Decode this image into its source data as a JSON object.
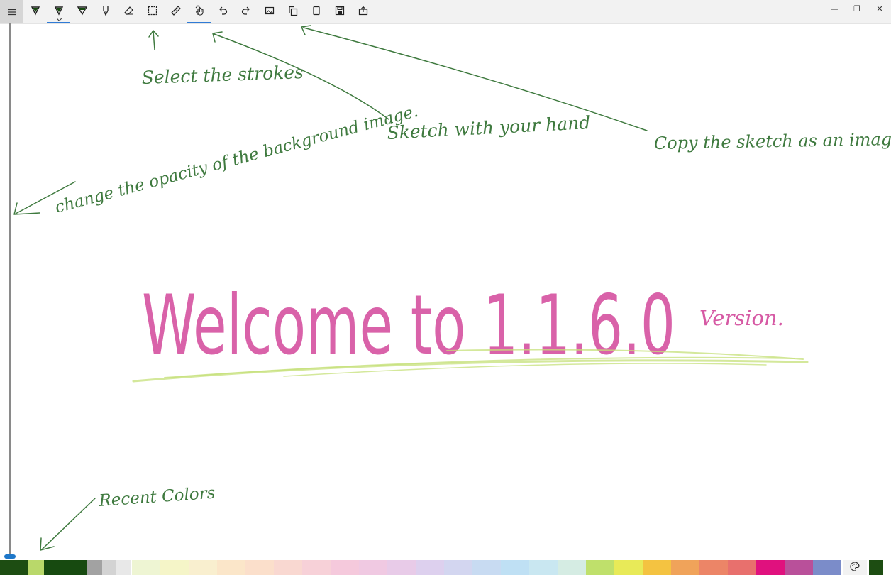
{
  "window": {
    "minimize_glyph": "—",
    "restore_glyph": "❐",
    "close_glyph": "✕"
  },
  "toolbar": {
    "tools": [
      {
        "name": "menu-icon"
      },
      {
        "name": "pen-icon"
      },
      {
        "name": "pencil-icon",
        "selected": true,
        "has_dropdown": true
      },
      {
        "name": "highlighter-icon"
      },
      {
        "name": "calligraphy-pen-icon"
      },
      {
        "name": "eraser-icon"
      },
      {
        "name": "selection-icon"
      },
      {
        "name": "ruler-icon"
      },
      {
        "name": "touch-writing-icon",
        "selected": true
      },
      {
        "name": "undo-icon"
      },
      {
        "name": "redo-icon"
      },
      {
        "name": "background-image-icon"
      },
      {
        "name": "copy-icon"
      },
      {
        "name": "page-icon"
      },
      {
        "name": "save-icon"
      },
      {
        "name": "share-icon"
      }
    ]
  },
  "annotations": {
    "select_strokes": "Select the strokes",
    "sketch_with_hand": "Sketch with your hand",
    "copy_sketch": "Copy the sketch as an image.",
    "opacity": "change the opacity of the background image.",
    "recent_colors": "Recent Colors"
  },
  "welcome": {
    "title": "Welcome to 1.1.6.0",
    "suffix": "Version."
  },
  "colors": {
    "ink_annotation": "#3f7a3f",
    "ink_welcome": "#d2479a",
    "ink_underline": "#c6e07a",
    "accent": "#2f7bd6",
    "recent": [
      "#1d4d12",
      "#b9d86a",
      "#174a10",
      "#174a10",
      "#a2a2a2",
      "#d3d3d3",
      "#e8e8e8"
    ],
    "palette": [
      "#eef5d3",
      "#f5f5c8",
      "#f9efcf",
      "#fbe6c9",
      "#fbdfcb",
      "#f9d8d1",
      "#f7d1d8",
      "#f5c9dc",
      "#f0c9e2",
      "#e8cbe8",
      "#ddd0ee",
      "#d3d6f0",
      "#c8dbf2",
      "#bfe0f4",
      "#c9e7f1",
      "#d5ece3",
      "#bfe06b",
      "#e8ea58",
      "#f4c341",
      "#f0a35a",
      "#ec8567",
      "#e8706d",
      "#e0117e",
      "#b9509a",
      "#7b8cc9"
    ],
    "last_swatch": "#1d4d12"
  }
}
